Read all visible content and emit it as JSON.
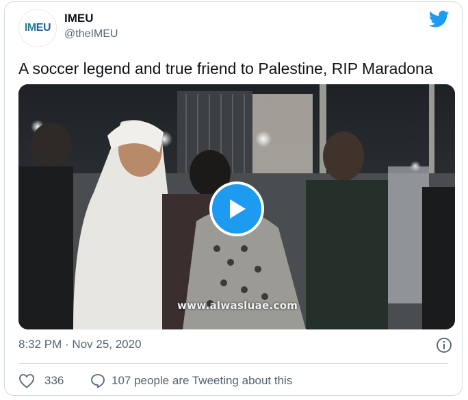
{
  "author": {
    "avatar_text": "IMEU",
    "display_name": "IMEU",
    "handle": "@theIMEU"
  },
  "platform_icon": "twitter-bird-icon",
  "tweet": {
    "text": "A soccer legend and true friend to Palestine, RIP Maradona"
  },
  "media": {
    "type": "video",
    "watermark": "www.alwasluae.com",
    "play_icon": "play-icon"
  },
  "meta": {
    "timestamp": "8:32 PM · Nov 25, 2020",
    "info_icon": "info-icon"
  },
  "actions": {
    "likes": "336",
    "replies_text": "107 people are Tweeting about this"
  },
  "colors": {
    "accent": "#1d9bf0",
    "text": "#0f1419",
    "secondary": "#536471",
    "border": "#cfd9de"
  }
}
